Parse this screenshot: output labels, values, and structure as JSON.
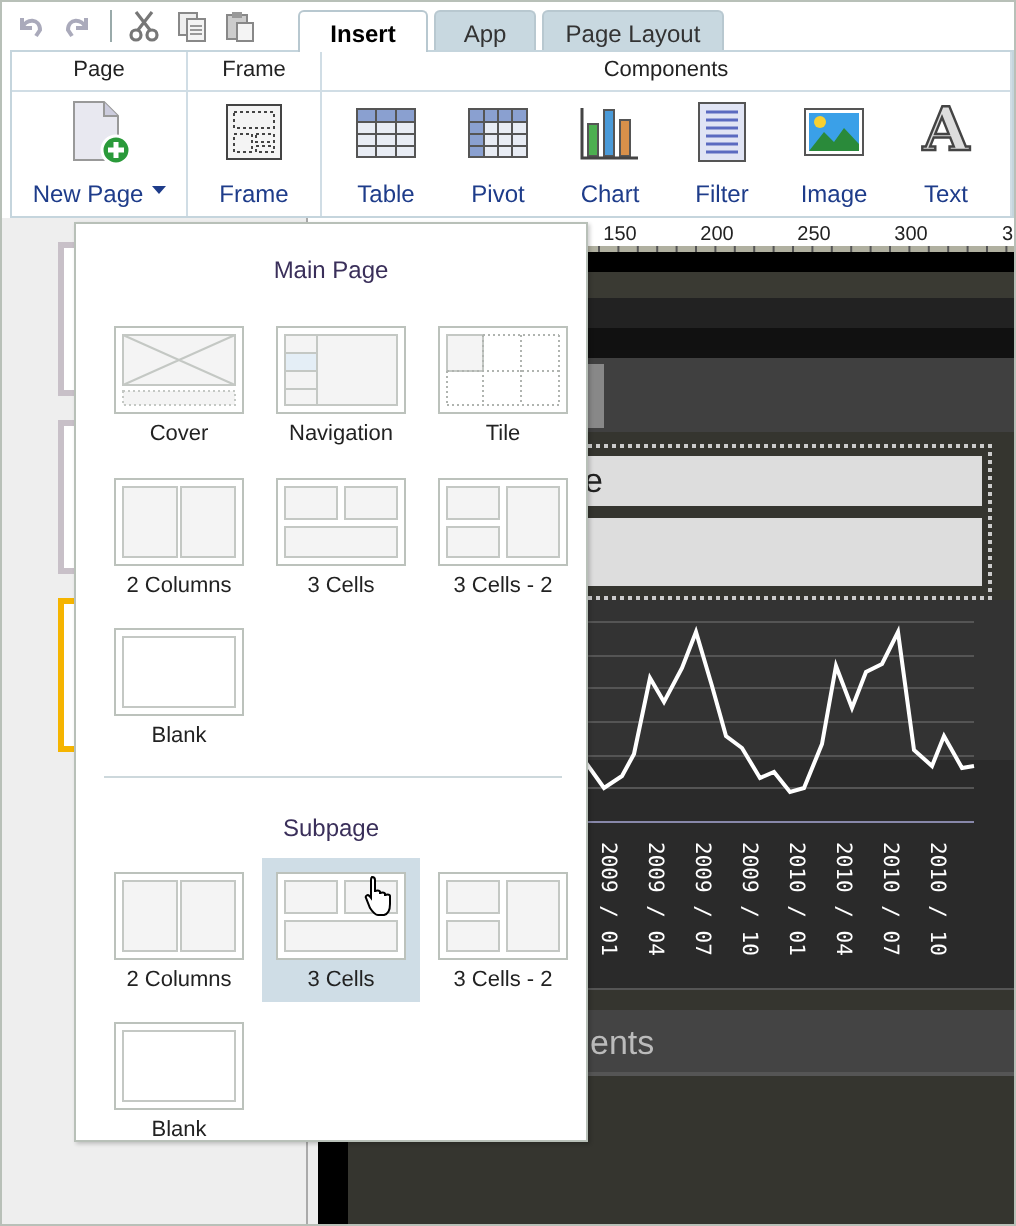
{
  "tabs": [
    {
      "label": "Insert",
      "selected": true
    },
    {
      "label": "App",
      "selected": false
    },
    {
      "label": "Page Layout",
      "selected": false
    }
  ],
  "ribbon_groups": [
    {
      "title": "Page",
      "buttons": [
        {
          "kind": "new-page",
          "label": "New Page",
          "dropdown": true
        }
      ]
    },
    {
      "title": "Frame",
      "buttons": [
        {
          "kind": "frame",
          "label": "Frame",
          "dropdown": false
        }
      ]
    },
    {
      "title": "Components",
      "buttons": [
        {
          "kind": "table",
          "label": "Table",
          "dropdown": false
        },
        {
          "kind": "pivot",
          "label": "Pivot",
          "dropdown": false
        },
        {
          "kind": "chart",
          "label": "Chart",
          "dropdown": false
        },
        {
          "kind": "filter",
          "label": "Filter",
          "dropdown": false
        },
        {
          "kind": "image",
          "label": "Image",
          "dropdown": false
        },
        {
          "kind": "text",
          "label": "Text",
          "glyph": "A",
          "dropdown": false
        }
      ]
    }
  ],
  "pages": [
    {
      "selected": false
    },
    {
      "selected": false
    },
    {
      "selected": true
    }
  ],
  "ruler": {
    "labels": [
      "150",
      "200",
      "250",
      "300",
      "3"
    ]
  },
  "canvas": {
    "title_fragment": "e",
    "chart": {
      "x_labels": [
        "2009 / 01",
        "2009 / 04",
        "2009 / 07",
        "2009 / 10",
        "2010 / 01",
        "2010 / 04",
        "2010 / 07",
        "2010 / 10"
      ]
    },
    "section_fragment": "ents"
  },
  "new_page_menu": {
    "sections": [
      {
        "title": "Main Page",
        "items": [
          {
            "label": "Cover",
            "kind": "cover",
            "selected": false
          },
          {
            "label": "Navigation",
            "kind": "navigation",
            "selected": false
          },
          {
            "label": "Tile",
            "kind": "tile",
            "selected": false
          },
          {
            "label": "2 Columns",
            "kind": "two-columns",
            "selected": false
          },
          {
            "label": "3 Cells",
            "kind": "three-cells",
            "selected": false
          },
          {
            "label": "3 Cells - 2",
            "kind": "three-cells-side",
            "selected": false
          },
          {
            "label": "Blank",
            "kind": "blank",
            "selected": false
          }
        ]
      },
      {
        "title": "Subpage",
        "items": [
          {
            "label": "2 Columns",
            "kind": "two-columns",
            "selected": false
          },
          {
            "label": "3 Cells",
            "kind": "three-cells",
            "selected": true
          },
          {
            "label": "3 Cells - 2",
            "kind": "three-cells-side",
            "selected": false
          },
          {
            "label": "Blank",
            "kind": "blank",
            "selected": false
          }
        ]
      }
    ]
  }
}
